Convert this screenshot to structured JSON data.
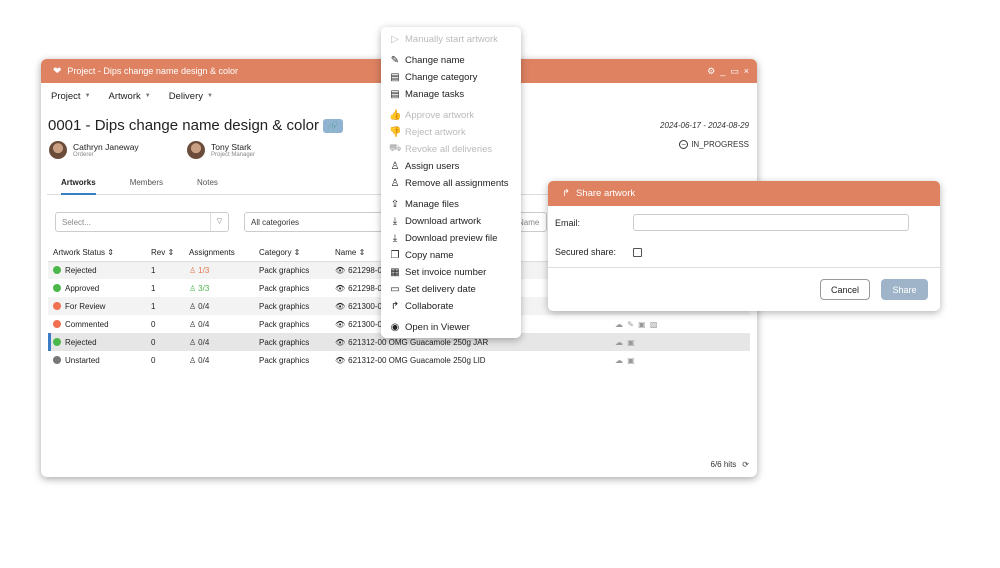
{
  "window": {
    "title": "Project - Dips change name design & color",
    "controls": {
      "settings": "⚙",
      "minimize": "_",
      "maximize": "▭",
      "close": "×"
    }
  },
  "menubar": [
    {
      "label": "Project"
    },
    {
      "label": "Artwork"
    },
    {
      "label": "Delivery"
    }
  ],
  "project": {
    "title": "0001 - Dips change name design & color",
    "date_range": "2024-06-17 - 2024-08-29",
    "status": "IN_PROGRESS",
    "people": [
      {
        "name": "Cathryn Janeway",
        "role": "Orderer"
      },
      {
        "name": "Tony Stark",
        "role": "Project Manager"
      }
    ]
  },
  "tabs": [
    {
      "label": "Artworks",
      "active": true
    },
    {
      "label": "Members",
      "active": false
    },
    {
      "label": "Notes",
      "active": false
    }
  ],
  "filters": {
    "select_placeholder": "Select...",
    "category": "All categories",
    "name_placeholder": "Name"
  },
  "table": {
    "headers": [
      "Artwork Status ⇕",
      "Rev ⇕",
      "Assignments",
      "Category ⇕",
      "Name ⇕"
    ],
    "rows": [
      {
        "status": "Rejected",
        "color": "#4cb84c",
        "rev": "1",
        "assign": "1/3",
        "assign_color": "#e0784e",
        "category": "Pack graphics",
        "name": "621298-0",
        "files": "",
        "selected": false
      },
      {
        "status": "Approved",
        "color": "#4cb84c",
        "rev": "1",
        "assign": "3/3",
        "assign_color": "#4cb84c",
        "category": "Pack graphics",
        "name": "621298-0",
        "files": "",
        "selected": false
      },
      {
        "status": "For Review",
        "color": "#f07050",
        "rev": "1",
        "assign": "0/4",
        "assign_color": "#333333",
        "category": "Pack graphics",
        "name": "621300-0",
        "files": "",
        "selected": false
      },
      {
        "status": "Commented",
        "color": "#f07050",
        "rev": "0",
        "assign": "0/4",
        "assign_color": "#333333",
        "category": "Pack graphics",
        "name": "621300-0",
        "files": "☁ ✎ ▣ ▧",
        "selected": false
      },
      {
        "status": "Rejected",
        "color": "#4cb84c",
        "rev": "0",
        "assign": "0/4",
        "assign_color": "#333333",
        "category": "Pack graphics",
        "name": "621312-00 OMG Guacamole 250g JAR",
        "files": "☁ ▣",
        "selected": true
      },
      {
        "status": "Unstarted",
        "color": "#777777",
        "rev": "0",
        "assign": "0/4",
        "assign_color": "#333333",
        "category": "Pack graphics",
        "name": "621312-00 OMG Guacamole 250g LID",
        "files": "☁ ▣",
        "selected": false
      }
    ]
  },
  "hits": "6/6 hits",
  "context_menu": [
    {
      "label": "Manually start artwork",
      "icon": "▷",
      "disabled": true,
      "gap_after": true
    },
    {
      "label": "Change name",
      "icon": "✎",
      "disabled": false
    },
    {
      "label": "Change category",
      "icon": "▤",
      "disabled": false
    },
    {
      "label": "Manage tasks",
      "icon": "▤",
      "disabled": false,
      "gap_after": true
    },
    {
      "label": "Approve artwork",
      "icon": "👍",
      "disabled": true
    },
    {
      "label": "Reject artwork",
      "icon": "👎",
      "disabled": true
    },
    {
      "label": "Revoke all deliveries",
      "icon": "⛟",
      "disabled": true
    },
    {
      "label": "Assign users",
      "icon": "♙",
      "disabled": false
    },
    {
      "label": "Remove all assignments",
      "icon": "♙",
      "disabled": false,
      "gap_after": true
    },
    {
      "label": "Manage files",
      "icon": "⇪",
      "disabled": false
    },
    {
      "label": "Download artwork",
      "icon": "⤓",
      "disabled": false
    },
    {
      "label": "Download preview file",
      "icon": "⤓",
      "disabled": false
    },
    {
      "label": "Copy name",
      "icon": "❐",
      "disabled": false
    },
    {
      "label": "Set invoice number",
      "icon": "▦",
      "disabled": false
    },
    {
      "label": "Set delivery date",
      "icon": "▭",
      "disabled": false
    },
    {
      "label": "Collaborate",
      "icon": "↱",
      "disabled": false,
      "gap_after": true
    },
    {
      "label": "Open in Viewer",
      "icon": "◉",
      "disabled": false
    }
  ],
  "share": {
    "title": "Share artwork",
    "email_label": "Email:",
    "secured_label": "Secured share:",
    "cancel_label": "Cancel",
    "share_label": "Share"
  }
}
